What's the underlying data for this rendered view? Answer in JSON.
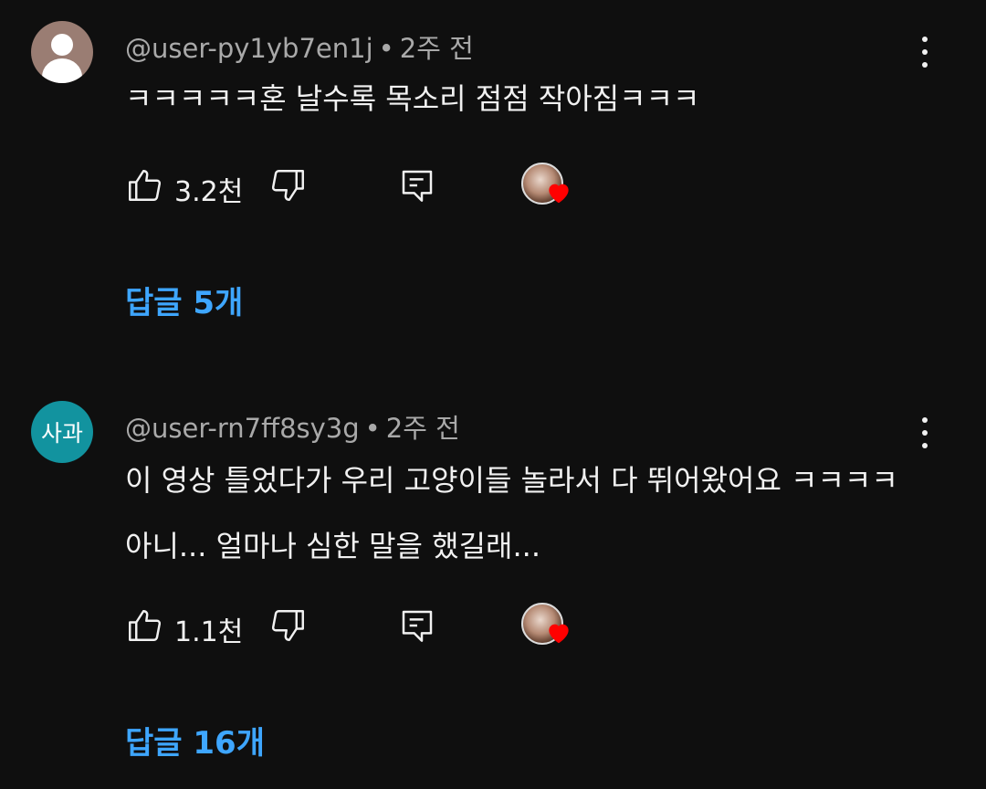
{
  "comments": [
    {
      "author": "@user-py1yb7en1j",
      "separator": "•",
      "time": "2주 전",
      "avatar_type": "default-person",
      "text": "ㅋㅋㅋㅋㅋ혼 날수록 목소리 점점 작아짐ㅋㅋㅋ",
      "likes": "3.2천",
      "creator_hearted": true,
      "replies_label": "답글 5개"
    },
    {
      "author": "@user-rn7ff8sy3g",
      "separator": "•",
      "time": "2주 전",
      "avatar_type": "text",
      "avatar_text": "사과",
      "avatar_color": "#12939f",
      "text": "이 영상 틀었다가 우리 고양이들 놀라서 다 뛰어왔어요 ㅋㅋㅋㅋ 아니... 얼마나 심한 말을 했길래...",
      "likes": "1.1천",
      "creator_hearted": true,
      "replies_label": "답글 16개"
    }
  ],
  "icons": {
    "like": "thumbs-up-icon",
    "dislike": "thumbs-down-icon",
    "reply": "comment-reply-icon",
    "more": "more-vertical-icon",
    "heart": "heart-icon"
  },
  "colors": {
    "background": "#0f0f0f",
    "link": "#3ea6ff",
    "meta": "#a9a9a9",
    "heart": "#ff0000"
  }
}
